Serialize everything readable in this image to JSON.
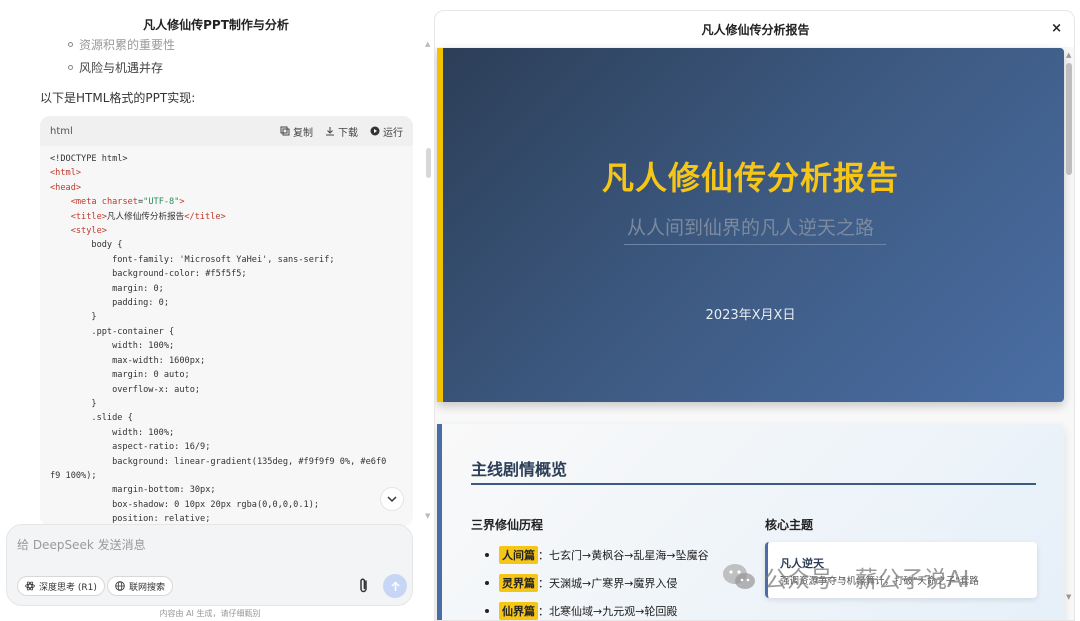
{
  "left": {
    "title": "凡人修仙传PPT制作与分析",
    "bullets": [
      "资源积累的重要性",
      "风险与机遇并存"
    ],
    "intro": "以下是HTML格式的PPT实现:",
    "code": {
      "lang": "html",
      "copy": "复制",
      "download": "下载",
      "run": "运行"
    },
    "chat": {
      "placeholder": "给 DeepSeek 发送消息",
      "deep_think": "深度思考 (R1)",
      "web_search": "联网搜索"
    },
    "footer": "内容由 AI 生成，请仔细甄别"
  },
  "right": {
    "header": "凡人修仙传分析报告",
    "close": "×",
    "slide1": {
      "title": "凡人修仙传分析报告",
      "subtitle": "从人间到仙界的凡人逆天之路",
      "date": "2023年X月X日"
    },
    "slide2": {
      "title": "主线剧情概览",
      "sec1": "三界修仙历程",
      "sec2": "核心主题",
      "arcs": [
        {
          "label": "人间篇",
          "text": "：七玄门→黄枫谷→乱星海→坠魔谷"
        },
        {
          "label": "灵界篇",
          "text": "：天渊城→广寒界→魔界入侵"
        },
        {
          "label": "仙界篇",
          "text": "：北寒仙域→九元观→轮回殿"
        }
      ],
      "theme_title": "凡人逆天",
      "theme_text": "强调资源争夺与机缘算计，打破\"天命之子\"套路"
    }
  },
  "watermark": "公众号 · 薪公子说AI",
  "colors": {
    "accent_gold": "#f5c518",
    "slide_blue": "#3d5a82"
  }
}
